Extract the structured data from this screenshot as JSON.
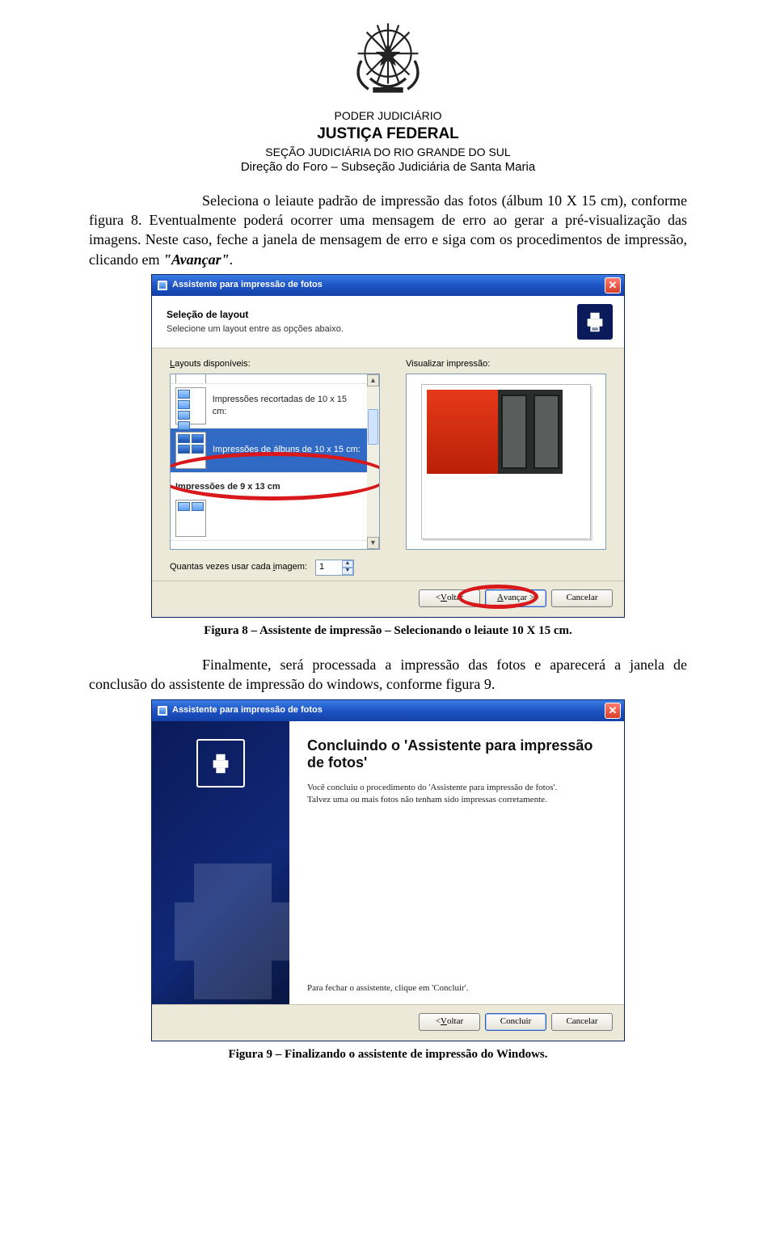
{
  "header": {
    "line1": "PODER JUDICIÁRIO",
    "line2": "JUSTIÇA FEDERAL",
    "line3": "SEÇÃO JUDICIÁRIA DO RIO GRANDE DO SUL",
    "line4": "Direção do Foro – Subseção Judiciária de Santa Maria"
  },
  "para1_pre": "Seleciona o leiaute padrão de impressão das fotos (álbum 10 X 15 cm), conforme figura 8. Eventualmente poderá ocorrer uma mensagem de erro ao gerar a pré-visualização das imagens. Neste caso, feche a janela de mensagem de erro e siga com os procedimentos de impressão, clicando em ",
  "para1_em": "\"Avançar\"",
  "para1_post": ".",
  "fig8": {
    "title": "Assistente para impressão de fotos",
    "wizard_title": "Seleção de layout",
    "wizard_sub": "Selecione um layout entre as opções abaixo.",
    "left_label_prefix": "L",
    "left_label_rest": "ayouts disponíveis:",
    "right_label": "Visualizar impressão:",
    "item_recortadas": "Impressões recortadas de 10 x 15 cm:",
    "item_albuns": "Impressões de álbuns de 10 x 15 cm:",
    "group_9x13": "Impressões de 9 x 13 cm",
    "qty_label_pre": "Quantas vezes usar cada ",
    "qty_label_u": "i",
    "qty_label_post": "magem:",
    "qty_value": "1",
    "btn_back_pre": "< ",
    "btn_back_u": "V",
    "btn_back_post": "oltar",
    "btn_next_u": "A",
    "btn_next_post": "vançar >",
    "btn_cancel": "Cancelar"
  },
  "caption8": "Figura 8 – Assistente de impressão – Selecionando o leiaute 10 X 15 cm.",
  "para2": "Finalmente, será processada a impressão das fotos e aparecerá a janela de conclusão do assistente de impressão do windows, conforme figura 9.",
  "fig9": {
    "title": "Assistente para impressão de fotos",
    "heading": "Concluindo o 'Assistente para impressão de fotos'",
    "body": "Você concluiu o procedimento do 'Assistente para impressão de fotos'. Talvez uma ou mais fotos não tenham sido impressas corretamente.",
    "foot": "Para fechar o assistente, clique em 'Concluir'.",
    "btn_back_pre": "< ",
    "btn_back_u": "V",
    "btn_back_post": "oltar",
    "btn_finish": "Concluir",
    "btn_cancel": "Cancelar"
  },
  "caption9": "Figura 9 – Finalizando o assistente de impressão do Windows."
}
